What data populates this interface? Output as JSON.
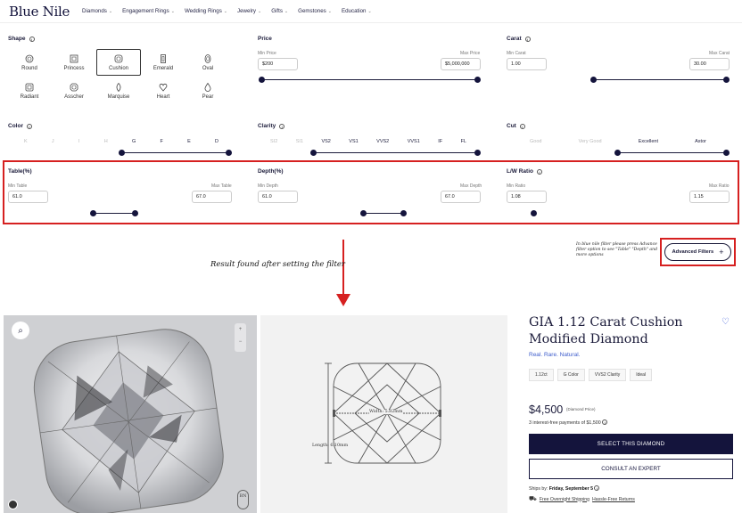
{
  "nav": {
    "logo": "Blue Nile",
    "items": [
      "Diamonds",
      "Engagement Rings",
      "Wedding Rings",
      "Jewelry",
      "Gifts",
      "Gemstones",
      "Education"
    ]
  },
  "shape": {
    "label": "Shape",
    "items": [
      {
        "label": "Round",
        "icon": "round-icon"
      },
      {
        "label": "Princess",
        "icon": "princess-icon"
      },
      {
        "label": "Cushion",
        "icon": "cushion-icon",
        "selected": true
      },
      {
        "label": "Emerald",
        "icon": "emerald-icon"
      },
      {
        "label": "Oval",
        "icon": "oval-icon"
      },
      {
        "label": "Radiant",
        "icon": "radiant-icon"
      },
      {
        "label": "Asscher",
        "icon": "asscher-icon"
      },
      {
        "label": "Marquise",
        "icon": "marquise-icon"
      },
      {
        "label": "Heart",
        "icon": "heart-icon"
      },
      {
        "label": "Pear",
        "icon": "pear-icon"
      }
    ]
  },
  "price": {
    "label": "Price",
    "min_label": "Min Price",
    "max_label": "Max Price",
    "min": "$200",
    "max": "$5,000,000"
  },
  "carat": {
    "label": "Carat",
    "min_label": "Min Carat",
    "max_label": "Max Carat",
    "min": "1.00",
    "max": "30.00"
  },
  "color": {
    "label": "Color",
    "grades": [
      "K",
      "J",
      "I",
      "H",
      "G",
      "F",
      "E",
      "D"
    ],
    "selected_from": 4
  },
  "clarity": {
    "label": "Clarity",
    "grades": [
      "SI2",
      "SI1",
      "VS2",
      "VS1",
      "VVS2",
      "VVS1",
      "IF",
      "FL"
    ],
    "selected_from": 2
  },
  "cut": {
    "label": "Cut",
    "grades": [
      "Good",
      "Very Good",
      "Excellent",
      "Astor"
    ],
    "selected_from": 2
  },
  "table": {
    "label": "Table(%)",
    "min_label": "Min Table",
    "max_label": "Max Table",
    "min": "61.0",
    "max": "67.0"
  },
  "depth": {
    "label": "Depth(%)",
    "min_label": "Min Depth",
    "max_label": "Max Depth",
    "min": "61.0",
    "max": "67.0"
  },
  "lw": {
    "label": "L/W Ratio",
    "min_label": "Min Ratio",
    "max_label": "Max Ratio",
    "min": "1.08",
    "max": "1.15"
  },
  "advanced": {
    "button": "Advanced Filters",
    "note": "In blue nile filter please press Advance filter option to see \"Table\" \"Depth\" and more options"
  },
  "annotation": {
    "result": "Result found after setting the filter"
  },
  "product": {
    "title": "GIA 1.12 Carat Cushion Modified Diamond",
    "tagline": "Real. Rare. Natural.",
    "chips": [
      "1.12ct",
      "G Color",
      "VVS2 Clarity",
      "Ideal"
    ],
    "price": "$4,500",
    "price_note": "(Diamond Price)",
    "installments": "3 interest-free payments of $1,500",
    "select_button": "SELECT THIS DIAMOND",
    "consult_button": "CONSULT AN EXPERT",
    "ships_label": "Ships by:",
    "ships_date": "Friday, September 5",
    "shipping_free": "Free Overnight Shipping",
    "shipping_returns": "Hassle-Free Returns",
    "width_label": "Width: 5.82mm",
    "length_label": "Length: 6.10mm",
    "zoom_in": "+",
    "zoom_out": "−",
    "brand_badge": "BN"
  },
  "colors": {
    "navy": "#14143c",
    "accent_blue": "#3d5ccc",
    "highlight_red": "#d62020"
  }
}
